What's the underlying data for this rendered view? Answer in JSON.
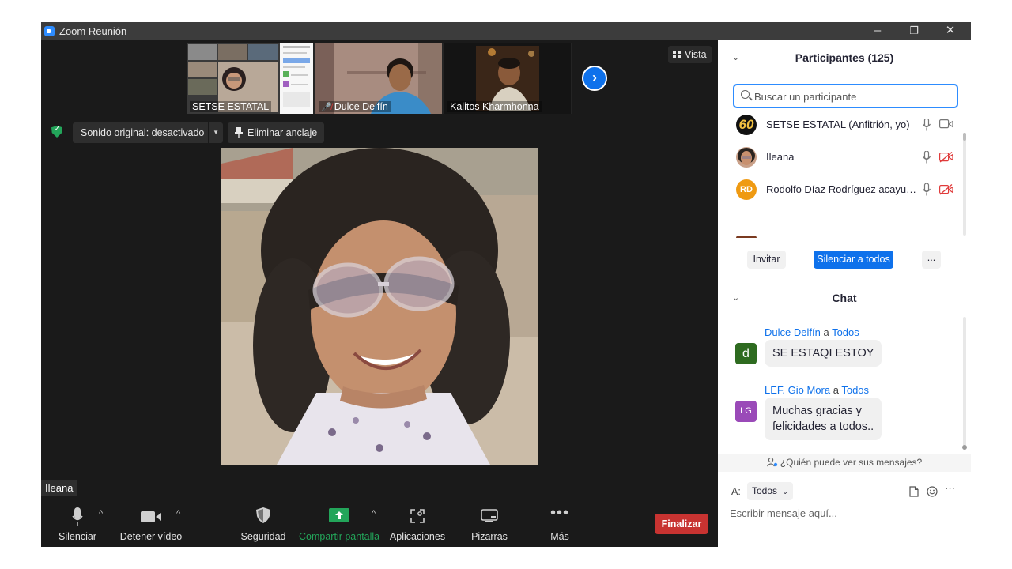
{
  "window": {
    "title": "Zoom Reunión",
    "controls": [
      "–",
      "❐",
      "✕"
    ]
  },
  "gallery": {
    "thumbnails": [
      {
        "name": "SETSE ESTATAL",
        "muted": false
      },
      {
        "name": "Dulce Delfín",
        "muted": true
      },
      {
        "name": "Kalitos Kharmhonna",
        "muted": false
      }
    ],
    "next_icon": "chevron-right-icon"
  },
  "view_button": {
    "label": "Vista",
    "icon": "grid-icon"
  },
  "audio_button": {
    "label": "Sonido original: desactivado"
  },
  "unpin_button": {
    "label": "Eliminar anclaje",
    "icon": "pin-icon"
  },
  "active_speaker": {
    "name": "Ileana"
  },
  "toolbar": {
    "mute": "Silenciar",
    "video": "Detener vídeo",
    "security": "Seguridad",
    "share": "Compartir pantalla",
    "apps": "Aplicaciones",
    "whiteboards": "Pizarras",
    "more": "Más",
    "end": "Finalizar"
  },
  "participants": {
    "title": "Participantes (125)",
    "search_placeholder": "Buscar un participante",
    "list": [
      {
        "name": "SETSE ESTATAL (Anfitrión, yo)",
        "avatar": "60",
        "video_on": true
      },
      {
        "name": "Ileana",
        "avatar": "",
        "video_on": false
      },
      {
        "name": "Rodolfo Díaz Rodríguez acayucan",
        "avatar": "RD",
        "video_on": false
      }
    ],
    "invite": "Invitar",
    "mute_all": "Silenciar a todos",
    "more": "..."
  },
  "chat": {
    "title": "Chat",
    "messages": [
      {
        "from": "Dulce Delfín",
        "connector": "a",
        "to": "Todos",
        "avatar": "d",
        "text": "SE ESTAQI ESTOY"
      },
      {
        "from": "LEF. Gio Mora",
        "connector": "a",
        "to": "Todos",
        "avatar": "LG",
        "text_line1": "Muchas gracias y",
        "text_line2": "felicidades a todos.."
      }
    ],
    "privacy": "¿Quién puede ver sus mensajes?",
    "to_label": "A:",
    "recipient": "Todos",
    "input_placeholder": "Escribir mensaje aquí...",
    "more": "···"
  },
  "colors": {
    "accent": "#0e71eb",
    "end_button": "#c83331",
    "share_green": "#23a55a",
    "background": "#1a1a1a"
  }
}
